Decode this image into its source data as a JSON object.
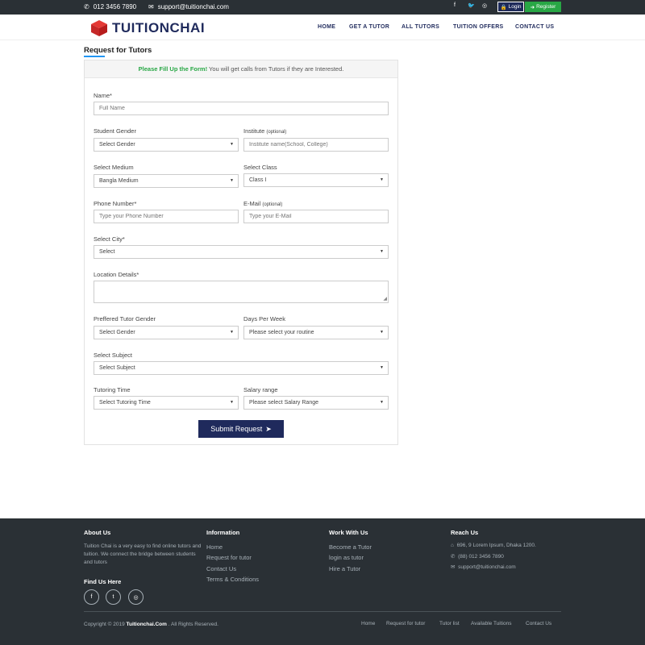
{
  "topbar": {
    "phone": "012 3456 7890",
    "email": "support@tuitionchai.com",
    "social_icons": [
      "facebook-icon",
      "twitter-icon",
      "instagram-icon"
    ],
    "login_label": "Login",
    "register_label": "Register"
  },
  "navbar": {
    "brand": "TUITIONCHAI",
    "items": [
      "HOME",
      "GET A TUTOR",
      "ALL TUTORS",
      "TUITION OFFERS",
      "CONTACT US"
    ]
  },
  "page": {
    "title": "Request for Tutors"
  },
  "form": {
    "notice_strong": "Please Fill Up the Form!",
    "notice_rest": " You will get calls from Tutors if they are Interested.",
    "name_label": "Name*",
    "name_placeholder": "Full Name",
    "gender_label": "Student Gender",
    "gender_value": "Select Gender",
    "institute_label": "Institute",
    "institute_optional": "(optional)",
    "institute_placeholder": "Institute name(School, College)",
    "medium_label": "Select Medium",
    "medium_value": "Bangla Medium",
    "class_label": "Select Class",
    "class_value": "Class I",
    "phone_label": "Phone Number*",
    "phone_placeholder": "Type your Phone Number",
    "email_label": "E-Mail",
    "email_optional": "(optional)",
    "email_placeholder": "Type your E-Mail",
    "city_label": "Select City*",
    "city_value": "Select",
    "location_label": "Location Details*",
    "tutor_gender_label": "Preffered Tutor Gender",
    "tutor_gender_value": "Select Gender",
    "days_label": "Days Per Week",
    "days_value": "Please select your routine",
    "subject_label": "Select Subject",
    "subject_value": "Select Subject",
    "time_label": "Tutoring Time",
    "time_value": "Select Tutoring Time",
    "salary_label": "Salary range",
    "salary_value": "Please select Salary Range",
    "submit_label": "Submit Request"
  },
  "footer": {
    "about_title": "About Us",
    "about_text": "Tuition Chai is a very easy to find online tutors and tuition. We connect the bridge between students and tutors",
    "find_title": "Find Us Here",
    "info_title": "Information",
    "info_links": [
      "Home",
      "Request for tutor",
      "Contact Us",
      "Terms & Conditions"
    ],
    "work_title": "Work With Us",
    "work_links": [
      "Become a Tutor",
      "login as tutor",
      "Hire a Tutor"
    ],
    "reach_title": "Reach Us",
    "address": "696, 9 Lorem Ipsum, Dhaka 1200.",
    "phone": "(88) 012 3456 7890",
    "email": "support@tuitionchai.com",
    "copyright_prefix": "Copyright © 2019",
    "copyright_brand": "Tuitionchai.Com",
    "copyright_suffix": ". All Rights Reserved.",
    "bottom_links": [
      "Home",
      "Request for tutor",
      "Tutor list",
      "Available Tuitions",
      "Contact Us"
    ]
  },
  "colors": {
    "dark": "#2a3035",
    "navy": "#1f2a5c",
    "green": "#28a745",
    "logo_red": "#d32f2f"
  }
}
